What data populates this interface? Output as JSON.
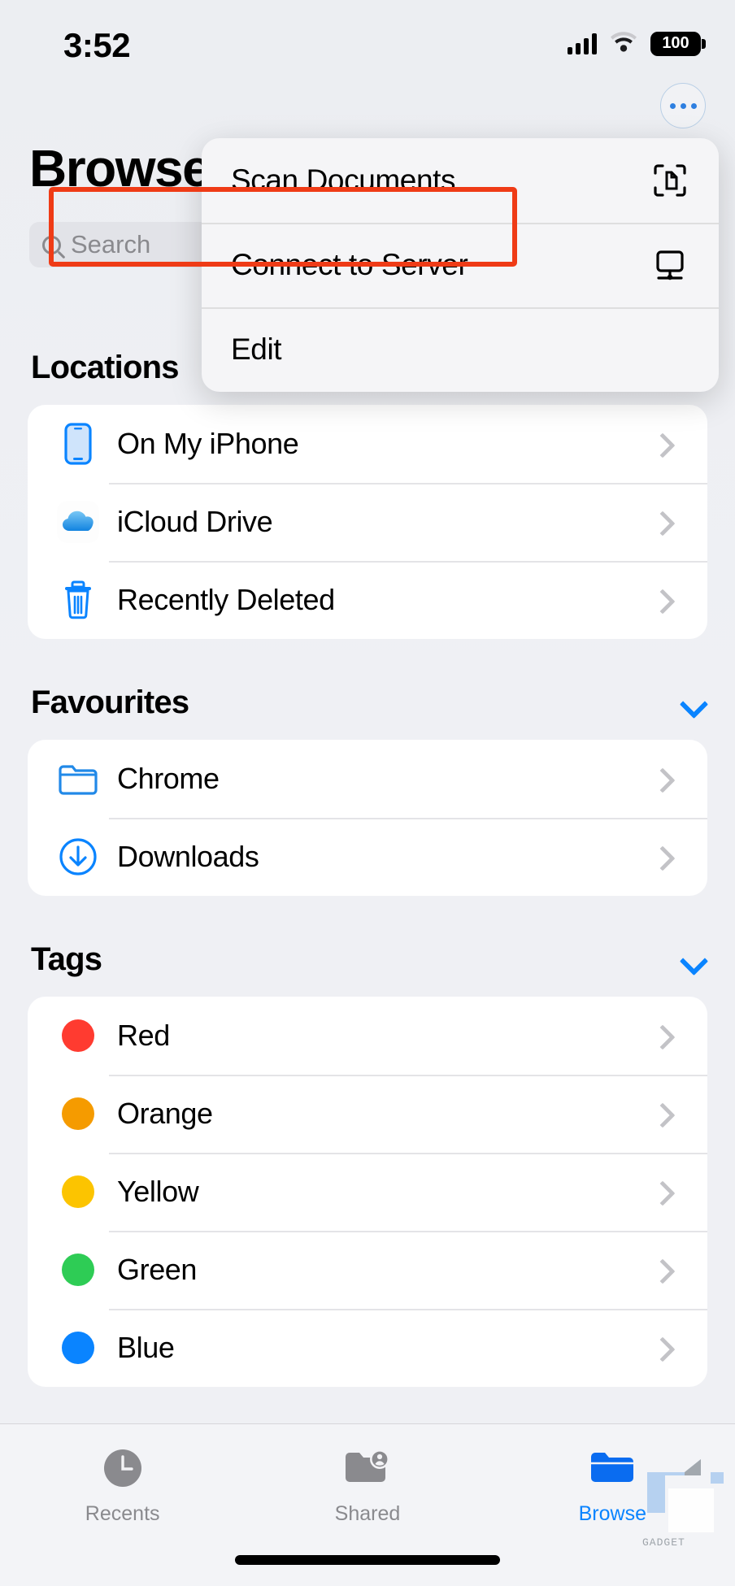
{
  "status_bar": {
    "time": "3:52",
    "signal_icon": "cellular-signal-icon",
    "wifi_icon": "wifi-icon",
    "battery_level": "100"
  },
  "nav": {
    "more_button_icon": "ellipsis-circle-icon",
    "title": "Browse"
  },
  "search": {
    "icon": "search-icon",
    "placeholder": "Search",
    "value": ""
  },
  "context_menu": {
    "items": [
      {
        "label": "Scan Documents",
        "icon": "document-scanner-icon",
        "highlighted": false
      },
      {
        "label": "Connect to Server",
        "icon": "display-network-icon",
        "highlighted": false
      },
      {
        "label": "Edit",
        "icon": "",
        "highlighted": true
      }
    ],
    "highlight_color": "#ef3b16"
  },
  "sections": [
    {
      "title": "Locations",
      "collapse_icon": "chevron-down-icon",
      "rows": [
        {
          "label": "On My iPhone",
          "icon": "iphone-icon",
          "accessory": "chevron-right-icon"
        },
        {
          "label": "iCloud Drive",
          "icon": "icloud-icon",
          "accessory": "chevron-right-icon"
        },
        {
          "label": "Recently Deleted",
          "icon": "trash-icon",
          "accessory": "chevron-right-icon"
        }
      ]
    },
    {
      "title": "Favourites",
      "collapse_icon": "chevron-down-icon",
      "rows": [
        {
          "label": "Chrome",
          "icon": "folder-icon",
          "accessory": "chevron-right-icon"
        },
        {
          "label": "Downloads",
          "icon": "download-circle-icon",
          "accessory": "chevron-right-icon"
        }
      ]
    },
    {
      "title": "Tags",
      "collapse_icon": "chevron-down-icon",
      "rows": [
        {
          "label": "Red",
          "icon": "tag-dot",
          "color": "#ff3b30",
          "accessory": "chevron-right-icon"
        },
        {
          "label": "Orange",
          "icon": "tag-dot",
          "color": "#f59b00",
          "accessory": "chevron-right-icon"
        },
        {
          "label": "Yellow",
          "icon": "tag-dot",
          "color": "#fcc400",
          "accessory": "chevron-right-icon"
        },
        {
          "label": "Green",
          "icon": "tag-dot",
          "color": "#2ecc55",
          "accessory": "chevron-right-icon"
        },
        {
          "label": "Blue",
          "icon": "tag-dot",
          "color": "#0a84ff",
          "accessory": "chevron-right-icon"
        }
      ]
    }
  ],
  "tab_bar": {
    "tabs": [
      {
        "label": "Recents",
        "icon": "clock-icon",
        "active": false
      },
      {
        "label": "Shared",
        "icon": "shared-folder-icon",
        "active": false
      },
      {
        "label": "Browse",
        "icon": "folder-filled-icon",
        "active": true
      }
    ],
    "active_color": "#0a84ff",
    "inactive_color": "#8a8a8e"
  },
  "watermark": {
    "text": "GADGET"
  }
}
